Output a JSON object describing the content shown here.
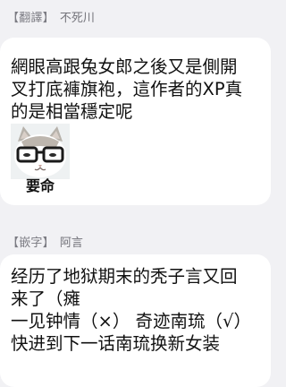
{
  "messages": [
    {
      "tag": "【翻譯】",
      "sender": "不死川",
      "lines": [
        "網眼高跟兔女郎之後又是側開",
        "叉打底褲旗袍，這作者的XP真",
        "的是相當穩定呢"
      ],
      "sticker": {
        "icon": "cat-with-glasses-icon",
        "caption": "要命"
      }
    },
    {
      "tag": "【嵌字】",
      "sender": "阿言",
      "lines": [
        "经历了地狱期末的秃子言又回",
        "来了（瘫",
        "一见钟情（×） 奇迹南琉（√）",
        "快进到下一话南琉换新女装"
      ]
    }
  ]
}
